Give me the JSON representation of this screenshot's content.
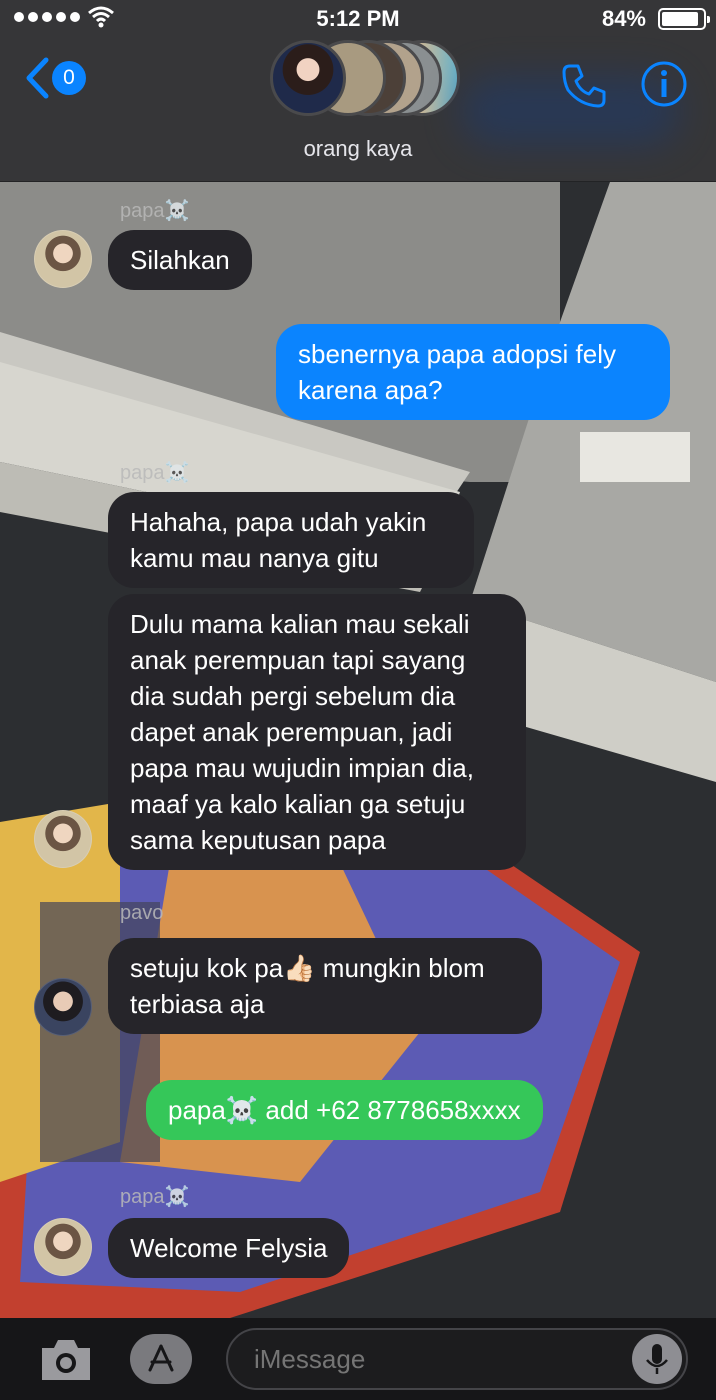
{
  "status_bar": {
    "time": "5:12 PM",
    "battery": "84%"
  },
  "header": {
    "back_count": "0",
    "group_name": "orang kaya"
  },
  "messages": [
    {
      "sender": "papa☠️",
      "text": "Silahkan"
    },
    {
      "text": "sbenernya papa adopsi fely\nkarena apa?"
    },
    {
      "sender": "papa☠️",
      "text": "Hahaha, papa udah yakin\nkamu mau nanya gitu"
    },
    {
      "text": "Dulu mama kalian mau sekali\nanak perempuan tapi sayang\ndia sudah pergi sebelum dia\ndapet anak perempuan, jadi\npapa mau wujudin impian dia,\nmaaf ya kalo kalian ga setuju\nsama keputusan papa"
    },
    {
      "sender": "pavo",
      "text": "setuju kok pa👍🏻 mungkin blom\nterbiasa aja"
    },
    {
      "text": "papa☠️ add +62 8778658xxxx"
    },
    {
      "sender": "papa☠️",
      "text": "Welcome Felysia"
    }
  ],
  "input": {
    "placeholder": "iMessage"
  },
  "colors": {
    "accent": "#0a84ff",
    "green_bubble": "#35c759",
    "incoming_bubble": "#26252a"
  }
}
